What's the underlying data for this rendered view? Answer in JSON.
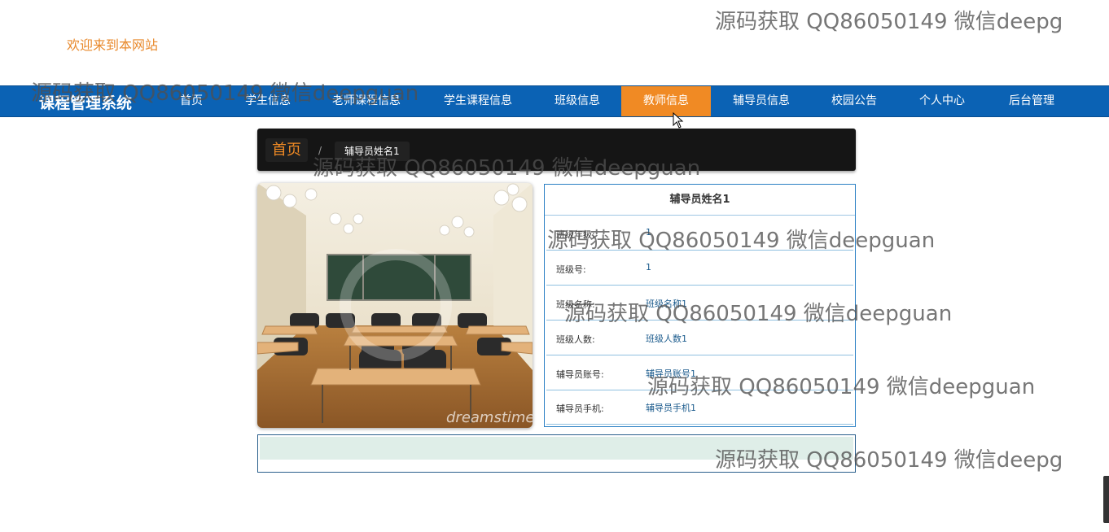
{
  "header": {
    "welcome": "欢迎来到本网站"
  },
  "nav": {
    "brand": "课程管理系统",
    "items": [
      {
        "label": "首页",
        "active": false
      },
      {
        "label": "学生信息",
        "active": false
      },
      {
        "label": "老师课程信息",
        "active": false
      },
      {
        "label": "学生课程信息",
        "active": false
      },
      {
        "label": "班级信息",
        "active": false
      },
      {
        "label": "教师信息",
        "active": true
      },
      {
        "label": "辅导员信息",
        "active": false
      },
      {
        "label": "校园公告",
        "active": false
      },
      {
        "label": "个人中心",
        "active": false
      },
      {
        "label": "后台管理",
        "active": false
      }
    ]
  },
  "breadcrumb": {
    "home": "首页",
    "separator": "/",
    "current": "辅导员姓名1"
  },
  "detail": {
    "title": "辅导员姓名1",
    "rows": [
      {
        "label": "班级年级:",
        "value": "1"
      },
      {
        "label": "班级号:",
        "value": "1"
      },
      {
        "label": "班级名称:",
        "value": "班级名称1"
      },
      {
        "label": "班级人数:",
        "value": "班级人数1"
      },
      {
        "label": "辅导员账号:",
        "value": "辅导员账号1"
      },
      {
        "label": "辅导员手机:",
        "value": "辅导员手机1"
      }
    ]
  },
  "photo": {
    "credit": "dreamstime"
  },
  "watermarks": [
    "源码获取 QQ86050149 微信deepg",
    "源码获取 QQ86050149 微信deepguan",
    "源码获取 QQ86050149 微信deepguan",
    "源码获取 QQ86050149 微信deepguan",
    "源码获取 QQ86050149 微信deepguan",
    "源码获取 QQ86050149 微信deepguan",
    "源码获取 QQ86050149 微信deepg"
  ],
  "colors": {
    "nav_bg": "#0b62b4",
    "nav_active": "#f08a24",
    "welcome": "#e8892c",
    "breadcrumb_bg": "#151515"
  }
}
